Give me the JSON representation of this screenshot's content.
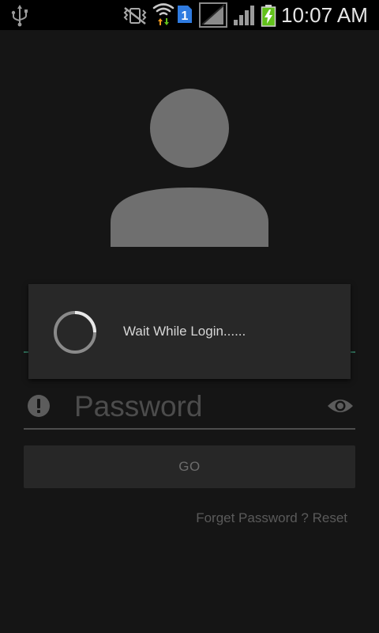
{
  "status_bar": {
    "time": "10:07 AM",
    "sim_slot": "1",
    "icons": [
      "usb-icon",
      "vibrate-icon",
      "wifi-icon",
      "sim-icon",
      "no-signal-icon",
      "signal-icon",
      "battery-charging-icon"
    ]
  },
  "login": {
    "avatar_icon": "person-placeholder-icon",
    "password_placeholder": "Password",
    "alert_icon": "alert-circle-icon",
    "visibility_icon": "eye-icon",
    "go_label": "GO",
    "forget_label": "Forget Password ? Reset"
  },
  "dialog": {
    "message": "Wait While Login......",
    "spinner_icon": "loading-spinner-icon"
  },
  "colors": {
    "background": "#151515",
    "status_bar": "#000000",
    "dialog": "#282828",
    "accent_underline": "#2e6b57",
    "battery_green": "#62c11b",
    "sim_blue": "#2f7be0",
    "wifi_orange": "#f39b1d"
  }
}
